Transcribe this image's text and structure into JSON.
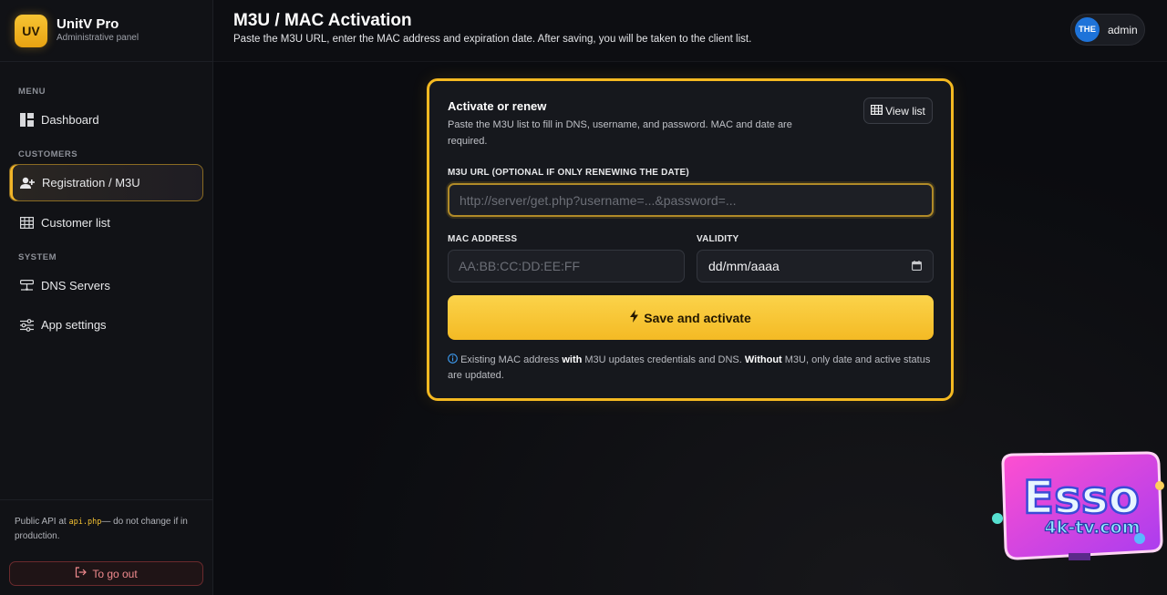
{
  "brand": {
    "logo": "UV",
    "title": "UnitV Pro",
    "subtitle": "Administrative panel"
  },
  "sidebar": {
    "sections": [
      {
        "label": "MENU"
      },
      {
        "label": "CUSTOMERS"
      },
      {
        "label": "SYSTEM"
      }
    ],
    "items": [
      {
        "label": "Dashboard",
        "icon": "dashboard-icon",
        "active": false
      },
      {
        "label": "Registration / M3U",
        "icon": "add-user-icon",
        "active": true
      },
      {
        "label": "Customer list",
        "icon": "table-icon",
        "active": false
      },
      {
        "label": "DNS Servers",
        "icon": "dns-server-icon",
        "active": false
      },
      {
        "label": "App settings",
        "icon": "sliders-icon",
        "active": false
      }
    ],
    "footer_prefix": "Public API at ",
    "footer_code": "api.php",
    "footer_suffix": "— do not change if in production.",
    "logout_label": "To go out"
  },
  "header": {
    "title": "M3U / MAC Activation",
    "subtitle": "Paste the M3U URL, enter the MAC address and expiration date. After saving, you will be taken to the client list.",
    "user_initials": "THE",
    "user_name": "admin"
  },
  "card": {
    "title": "Activate or renew",
    "description": "Paste the M3U list to fill in DNS, username, and password. MAC and date are required.",
    "view_list_label": "View list",
    "m3u_label": "M3U URL (OPTIONAL IF ONLY RENEWING THE DATE)",
    "m3u_placeholder": "http://server/get.php?username=...&password=...",
    "mac_label": "MAC ADDRESS",
    "mac_placeholder": "AA:BB:CC:DD:EE:FF",
    "validity_label": "VALIDITY",
    "validity_value": "dd/mm/aaaa",
    "save_label": "Save and activate",
    "note_part1": "Existing MAC address ",
    "note_with": "with",
    "note_part2": " M3U updates credentials and DNS. ",
    "note_without": "Without",
    "note_part3": " M3U, only date and active status are updated."
  },
  "watermark": {
    "line1": "Esso",
    "line2": "4k-tv.com"
  },
  "colors": {
    "accent": "#f4b921",
    "background": "#0b0c10",
    "danger": "#f08a8e",
    "avatar": "#1e73d9"
  }
}
